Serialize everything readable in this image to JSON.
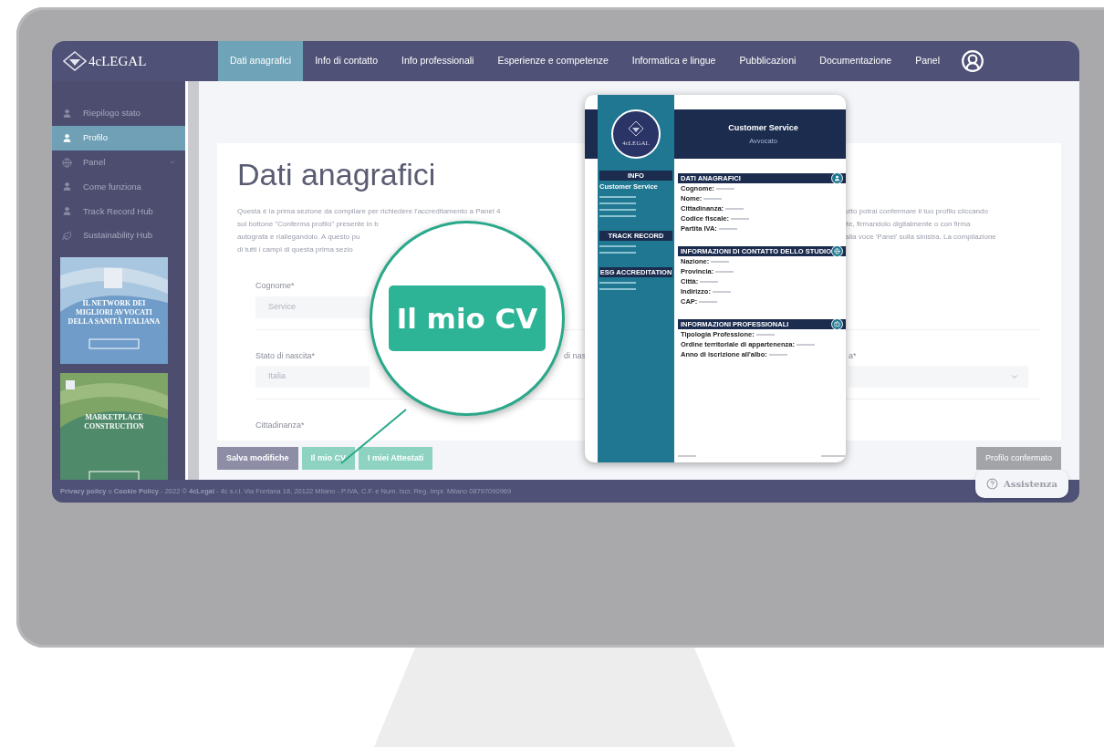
{
  "nav": {
    "logo": "4cLEGAL",
    "tabs": [
      {
        "label": "Dati anagrafici",
        "selected": true
      },
      {
        "label": "Info di contatto",
        "selected": false
      },
      {
        "label": "Info professionali",
        "selected": false
      },
      {
        "label": "Esperienze e competenze",
        "selected": false
      },
      {
        "label": "Informatica e lingue",
        "selected": false
      },
      {
        "label": "Pubblicazioni",
        "selected": false
      },
      {
        "label": "Documentazione",
        "selected": false
      },
      {
        "label": "Panel",
        "selected": false
      }
    ]
  },
  "sidebar": {
    "items": [
      {
        "label": "Riepilogo stato",
        "kind": "person",
        "selected": false,
        "submenu": false
      },
      {
        "label": "Profilo",
        "kind": "person",
        "selected": true,
        "submenu": false
      },
      {
        "label": "Panel",
        "kind": "globe",
        "selected": false,
        "submenu": true
      },
      {
        "label": "Come funziona",
        "kind": "person",
        "selected": false,
        "submenu": false
      },
      {
        "label": "Track Record Hub",
        "kind": "person",
        "selected": false,
        "submenu": false
      },
      {
        "label": "Sustainability Hub",
        "kind": "leaf",
        "selected": false,
        "submenu": false
      }
    ],
    "banners": [
      {
        "kind": "network",
        "text": "IL NETWORK DEI MIGLIORI AVVOCATI DELLA SANITÀ ITALIANA"
      },
      {
        "kind": "construction",
        "text": "MARKETPLACE CONSTRUCTION"
      }
    ]
  },
  "page": {
    "title": "Dati anagrafici",
    "intro": [
      {
        "left": "Questa è la prima sezione da compilare per richiedere l'accreditamento a Panel 4",
        "right": "utto potrai confermare il tuo profilo cliccando"
      },
      {
        "left": "sul bottone \"Conferma profilo\" presente in b",
        "right": "ite, firmandolo digitalmente o con firma"
      },
      {
        "left": "autografa e riallegandolo. A questo pu",
        "right": "alla voce 'Panel' sulla sinistra. La compilazione"
      },
      {
        "left": "di tutti i campi di questa prima sezio"
      }
    ],
    "rows": [
      [
        {
          "kind": "text",
          "label": "Cognome*",
          "value": "Service"
        }
      ],
      [
        {
          "kind": "text",
          "label": "Stato di nascita*",
          "value": "Italia"
        },
        {
          "kind": "partial",
          "label": "di nas"
        },
        {
          "kind": "select",
          "label": "a*"
        }
      ],
      [
        {
          "kind": "label",
          "label": "Cittadinanza*"
        }
      ]
    ]
  },
  "actions": [
    {
      "label": "Salva modifiche",
      "kind": "save"
    },
    {
      "label": "Il mio CV",
      "kind": "cv"
    },
    {
      "label": "I miei Attestati",
      "kind": "cv"
    }
  ],
  "confirm": {
    "label": "Profilo confermato",
    "disabled": true
  },
  "help": "Assistenza",
  "footer": "**Privacy policy** o **Cookie Policy** - 2022 © **4cLegal** - 4c s.r.l. Via Fontana 18, 20122 Milano - P.IVA, C.F. e Num. Iscr. Reg. Impr. Milano 08797090969",
  "cv": {
    "name": "Customer Service",
    "role": "Avvocato",
    "logo": "4cLEGAL",
    "side": [
      {
        "title": "INFO",
        "lines": [
          "Customer Service"
        ]
      },
      {
        "title": "TRACK RECORD"
      },
      {
        "title": "ESG ACCREDITATION"
      }
    ],
    "sections": [
      {
        "title": "DATI ANAGRAFICI",
        "kind": "person",
        "fields": [
          "Cognome:",
          "Nome:",
          "Cittadinanza:",
          "Codice fiscale:",
          "Partita IVA:"
        ]
      },
      {
        "title": "INFORMAZIONI DI CONTATTO DELLO STUDIO",
        "kind": "globe",
        "fields": [
          "Nazione:",
          "Provincia:",
          "Città:",
          "Indirizzo:",
          "CAP:"
        ]
      },
      {
        "title": "INFORMAZIONI PROFESSIONALI",
        "kind": "briefcase",
        "fields": [
          "Tipologia Professione:",
          "Ordine territoriale di appartenenza:",
          "Anno di iscrizione all'albo:"
        ]
      }
    ]
  },
  "magnifier": {
    "label": "Il mio CV"
  }
}
